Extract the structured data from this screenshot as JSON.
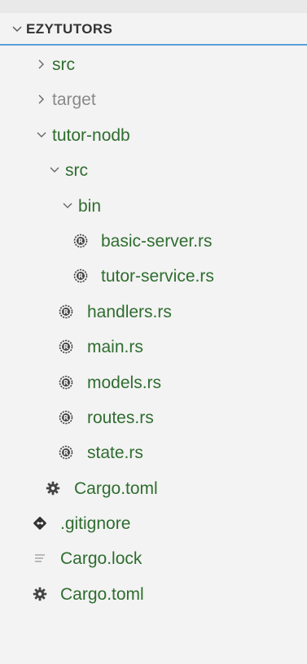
{
  "explorer": {
    "title": "EZYTUTORS",
    "items": [
      {
        "label": "src",
        "type": "folder",
        "state": "collapsed",
        "color": "#2f6d2f"
      },
      {
        "label": "target",
        "type": "folder",
        "state": "collapsed",
        "color": "#8a8a8a"
      },
      {
        "label": "tutor-nodb",
        "type": "folder",
        "state": "expanded",
        "color": "#2f6d2f"
      },
      {
        "label": "src",
        "type": "folder",
        "state": "expanded",
        "color": "#2f6d2f"
      },
      {
        "label": "bin",
        "type": "folder",
        "state": "expanded",
        "color": "#2f6d2f"
      },
      {
        "label": "basic-server.rs",
        "type": "file",
        "icon": "rust-file-icon",
        "color": "#2f6d2f"
      },
      {
        "label": "tutor-service.rs",
        "type": "file",
        "icon": "rust-file-icon",
        "color": "#2f6d2f"
      },
      {
        "label": "handlers.rs",
        "type": "file",
        "icon": "rust-file-icon",
        "color": "#2f6d2f"
      },
      {
        "label": "main.rs",
        "type": "file",
        "icon": "rust-file-icon",
        "color": "#2f6d2f"
      },
      {
        "label": "models.rs",
        "type": "file",
        "icon": "rust-file-icon",
        "color": "#2f6d2f"
      },
      {
        "label": "routes.rs",
        "type": "file",
        "icon": "rust-file-icon",
        "color": "#2f6d2f"
      },
      {
        "label": "state.rs",
        "type": "file",
        "icon": "rust-file-icon",
        "color": "#2f6d2f"
      },
      {
        "label": "Cargo.toml",
        "type": "file",
        "icon": "gear-icon",
        "color": "#2f6d2f"
      },
      {
        "label": ".gitignore",
        "type": "file",
        "icon": "git-icon",
        "color": "#2f6d2f"
      },
      {
        "label": "Cargo.lock",
        "type": "file",
        "icon": "lines-icon",
        "color": "#2f6d2f"
      },
      {
        "label": "Cargo.toml",
        "type": "file",
        "icon": "gear-icon",
        "color": "#2f6d2f"
      }
    ]
  }
}
